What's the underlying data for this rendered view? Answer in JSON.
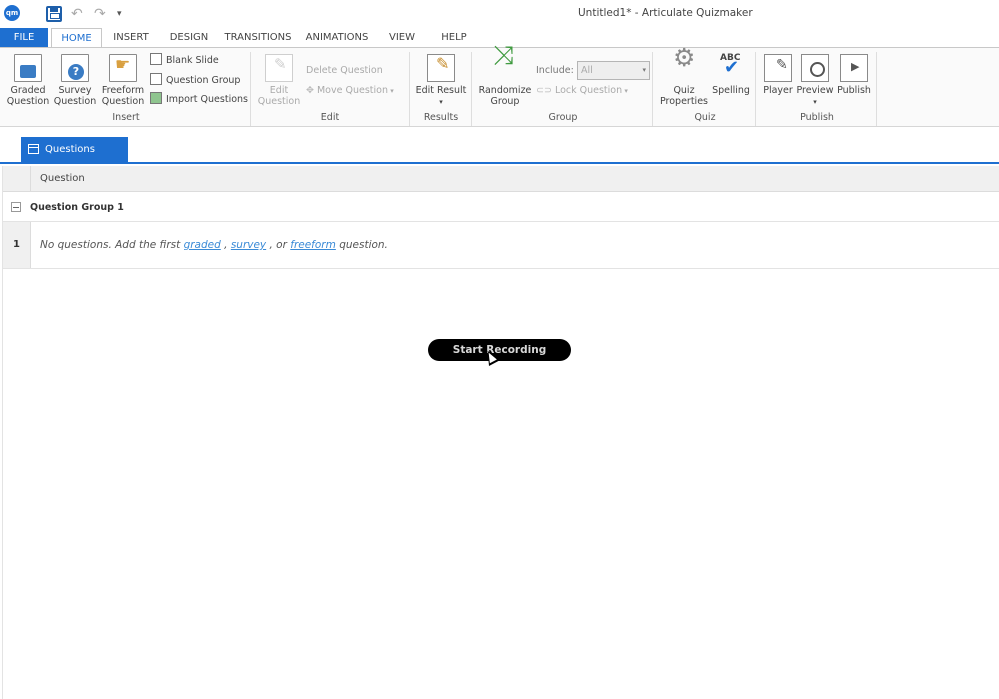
{
  "window": {
    "app_logo": "qm",
    "title": "Untitled1* -  Articulate Quizmaker"
  },
  "quick_access": {
    "icons": [
      "save-icon",
      "undo-icon",
      "redo-icon",
      "customize-icon"
    ]
  },
  "ribbon_tabs": [
    "FILE",
    "HOME",
    "INSERT",
    "DESIGN",
    "TRANSITIONS",
    "ANIMATIONS",
    "VIEW",
    "HELP"
  ],
  "ribbon": {
    "insert": {
      "graded": [
        "Graded",
        "Question"
      ],
      "survey": [
        "Survey",
        "Question"
      ],
      "freeform": [
        "Freeform",
        "Question"
      ],
      "blank_slide": "Blank Slide",
      "question_group": "Question Group",
      "import_questions": "Import Questions",
      "group_label": "Insert"
    },
    "edit": {
      "edit_question": [
        "Edit",
        "Question"
      ],
      "delete_question": "Delete Question",
      "move_question": "Move Question",
      "group_label": "Edit"
    },
    "results": {
      "edit_result": "Edit Result",
      "group_label": "Results"
    },
    "group": {
      "randomize": [
        "Randomize",
        "Group"
      ],
      "include_label": "Include:",
      "include_value": "All",
      "lock_question": "Lock Question",
      "group_label": "Group"
    },
    "quiz": {
      "properties": [
        "Quiz",
        "Properties"
      ],
      "spelling": "Spelling",
      "group_label": "Quiz"
    },
    "publish": {
      "player": "Player",
      "preview": "Preview",
      "publish": "Publish",
      "group_label": "Publish"
    }
  },
  "doc_tab": "Questions",
  "table": {
    "column_header": "Question",
    "group_name": "Question Group 1",
    "rows": [
      {
        "num": "1",
        "text_prefix": "No questions. Add the first ",
        "link_graded": "graded",
        "sep1": " , ",
        "link_survey": "survey",
        "sep2": " , or  ",
        "link_freeform": "freeform",
        "text_suffix": " question."
      }
    ]
  },
  "recording": {
    "label": "Start Recording"
  },
  "colors": {
    "accent": "#1e6fd0",
    "link": "#3a8ad6",
    "pill": "#000000"
  }
}
